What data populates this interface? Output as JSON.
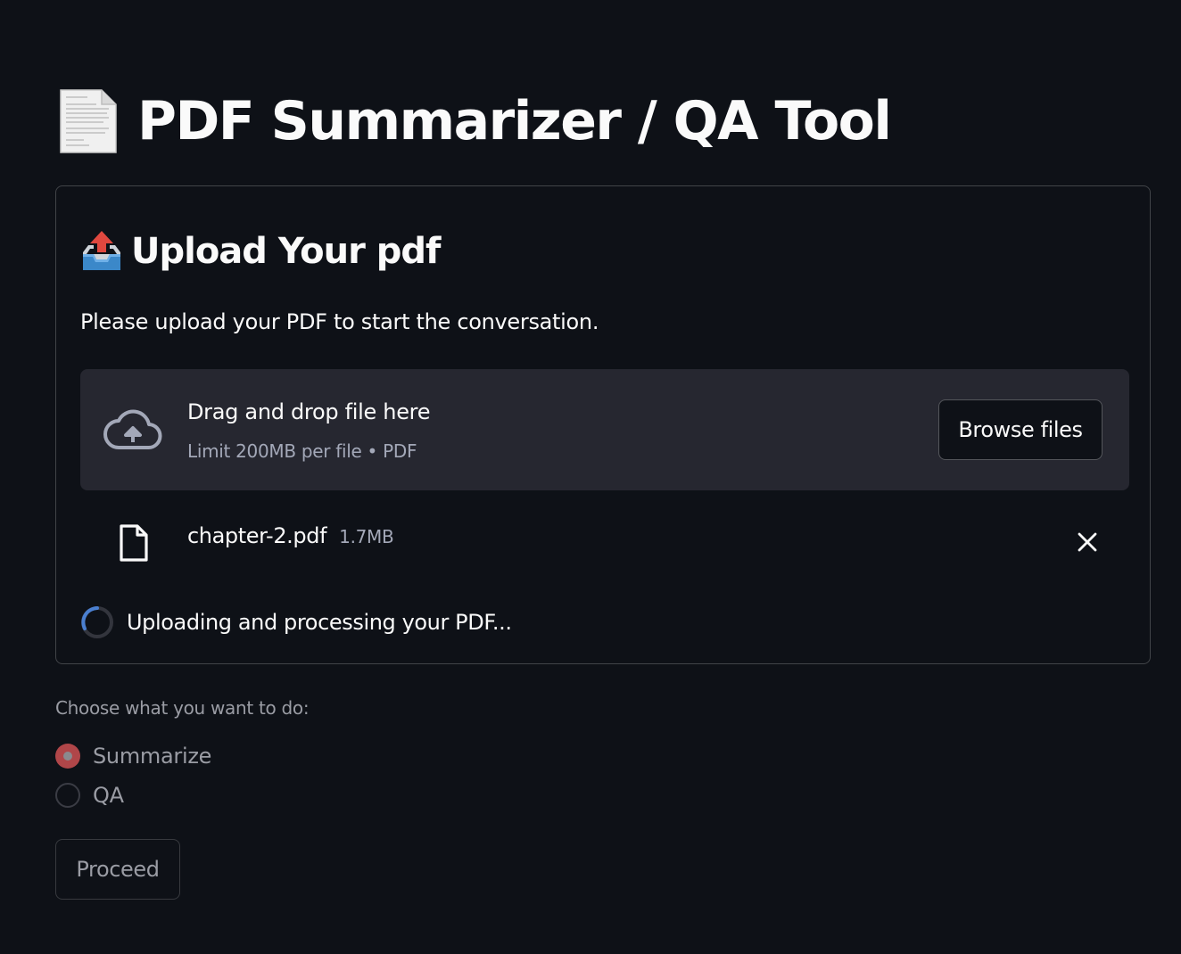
{
  "page": {
    "title": "PDF Summarizer / QA Tool",
    "title_icon": "page-facing-up-emoji"
  },
  "upload": {
    "heading": "Upload Your pdf",
    "heading_icon": "outbox-tray-emoji",
    "instruction": "Please upload your PDF to start the conversation.",
    "dropzone": {
      "icon": "cloud-upload-icon",
      "text": "Drag and drop file here",
      "limit": "Limit 200MB per file • PDF",
      "browse_label": "Browse files"
    },
    "file": {
      "icon": "file-icon",
      "name": "chapter-2.pdf",
      "size": "1.7MB",
      "remove_icon": "close-icon"
    },
    "status": {
      "icon": "spinner-icon",
      "text": "Uploading and processing your PDF..."
    }
  },
  "options": {
    "label": "Choose what you want to do:",
    "items": [
      {
        "label": "Summarize",
        "selected": true
      },
      {
        "label": "QA",
        "selected": false
      }
    ]
  },
  "actions": {
    "proceed_label": "Proceed"
  },
  "colors": {
    "background": "#0e1117",
    "dropzone_bg": "#262730",
    "radio_accent": "#b04649",
    "spinner_accent": "#4a7fd0"
  }
}
